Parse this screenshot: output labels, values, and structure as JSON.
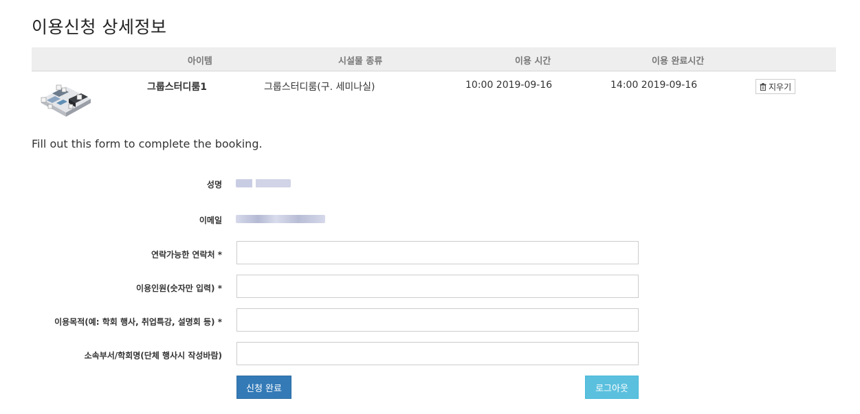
{
  "page": {
    "title": "이용신청 상세정보"
  },
  "table": {
    "headers": [
      "아이템",
      "시설물 종류",
      "이용 시간",
      "이용 완료시간"
    ],
    "rows": [
      {
        "item": "그룹스터디룸1",
        "facility": "그룹스터디룸(구. 세미나실)",
        "start": "10:00 2019-09-16",
        "end": "14:00 2019-09-16",
        "delete_label": "지우기"
      }
    ]
  },
  "intro": "Fill out this form to complete the booking.",
  "form": {
    "name_label": "성명",
    "email_label": "이메일",
    "phone_label": "연락가능한 연락처 *",
    "phone_value": "",
    "people_label": "이용인원(숫자만 입력) *",
    "people_value": "",
    "purpose_label": "이용목적(예: 학회 행사, 취업특강, 설명회 등) *",
    "purpose_value": "",
    "dept_label": "소속부서/학회명(단체 행사시 작성바람)",
    "dept_value": ""
  },
  "buttons": {
    "submit": "신청 완료",
    "logout": "로그아웃"
  },
  "colors": {
    "primary": "#337ab7",
    "info": "#5bc0de",
    "header_bg": "#eeeeee"
  },
  "icons": {
    "delete": "trash-icon",
    "thumbnail": "room-floorplan-thumbnail"
  }
}
